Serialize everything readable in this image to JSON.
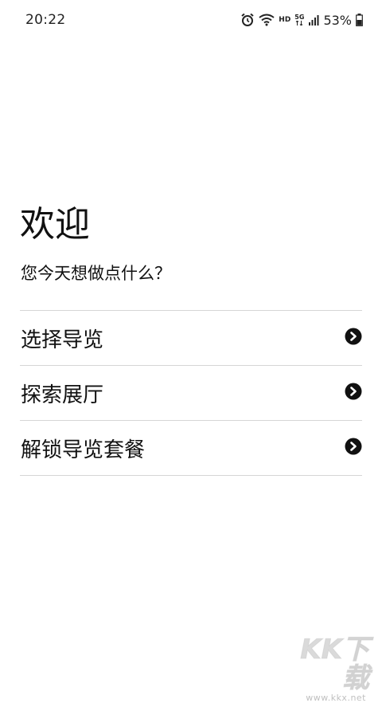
{
  "status_bar": {
    "time": "20:22",
    "network_label": "HD",
    "signal_label": "5G",
    "battery_percent": "53%",
    "icons": [
      "alarm-icon",
      "wifi-icon",
      "signal-icon",
      "battery-icon"
    ]
  },
  "welcome": {
    "title": "欢迎",
    "subtitle": "您今天想做点什么？"
  },
  "menu": {
    "items": [
      {
        "label": "选择导览",
        "icon": "chevron-right-icon"
      },
      {
        "label": "探索展厅",
        "icon": "chevron-right-icon"
      },
      {
        "label": "解锁导览套餐",
        "icon": "chevron-right-icon"
      }
    ]
  },
  "watermark": {
    "logo_text": "KK下载",
    "url": "www.kkx.net"
  },
  "colors": {
    "text": "#111111",
    "divider": "#d6d6d6",
    "background": "#ffffff"
  }
}
